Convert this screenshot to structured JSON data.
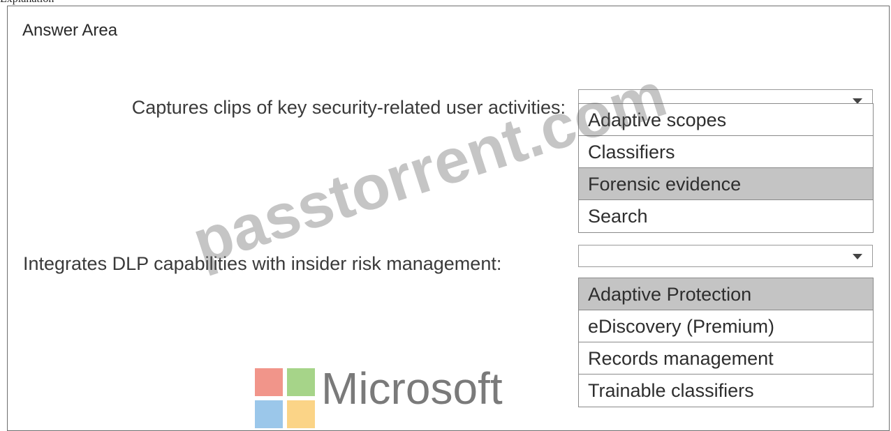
{
  "header_text": "Explanation",
  "answer_area": {
    "heading": "Answer Area",
    "questions": [
      {
        "prompt": "Captures clips of key security-related user activities:",
        "selected": "",
        "options": [
          "Adaptive scopes",
          "Classifiers",
          "Forensic evidence",
          "Search"
        ],
        "highlighted_index": 2
      },
      {
        "prompt": "Integrates DLP capabilities with insider risk management:",
        "selected": "",
        "options": [
          "Adaptive Protection",
          "eDiscovery (Premium)",
          "Records management",
          "Trainable classifiers"
        ],
        "highlighted_index": 0
      }
    ]
  },
  "watermark": "passtorrent.com",
  "logo": {
    "text": "Microsoft",
    "colors": [
      "#f1958a",
      "#a6d489",
      "#9bc7ea",
      "#fbd487"
    ]
  }
}
